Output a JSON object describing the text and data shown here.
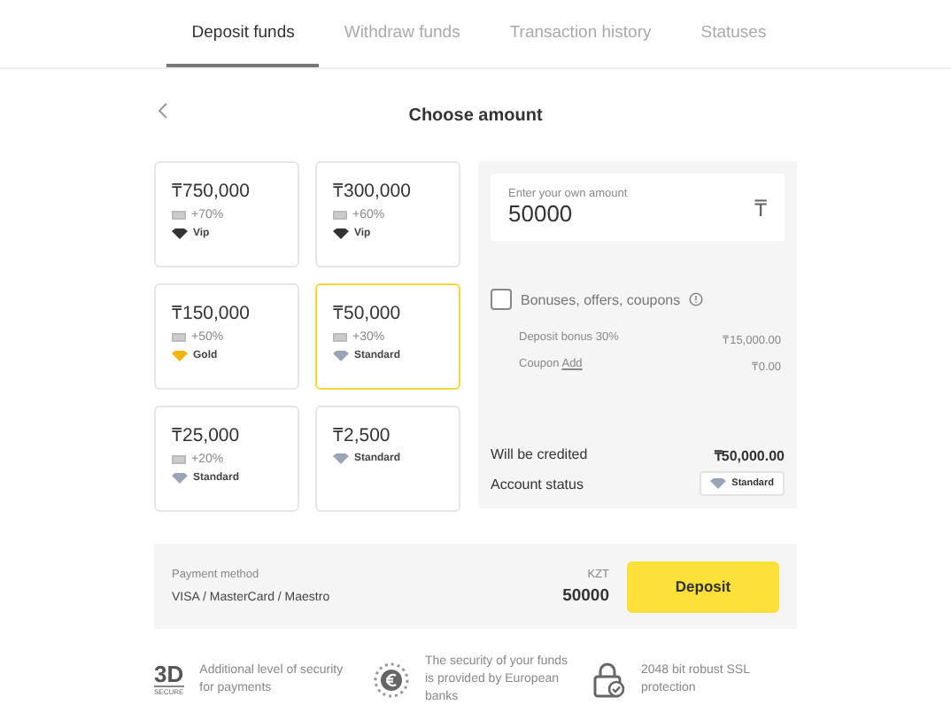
{
  "tabs": [
    {
      "label": "Deposit funds",
      "selected": true
    },
    {
      "label": "Withdraw funds",
      "selected": false
    },
    {
      "label": "Transaction history",
      "selected": false
    },
    {
      "label": "Statuses",
      "selected": false
    }
  ],
  "heading": "Choose amount",
  "amounts": [
    {
      "amount": "₸750,000",
      "bonus": "+70%",
      "tier": "Vip",
      "kind": "vip",
      "selected": false
    },
    {
      "amount": "₸300,000",
      "bonus": "+60%",
      "tier": "Vip",
      "kind": "vip",
      "selected": false
    },
    {
      "amount": "₸150,000",
      "bonus": "+50%",
      "tier": "Gold",
      "kind": "gold",
      "selected": false
    },
    {
      "amount": "₸50,000",
      "bonus": "+30%",
      "tier": "Standard",
      "kind": "standard",
      "selected": true
    },
    {
      "amount": "₸25,000",
      "bonus": "+20%",
      "tier": "Standard",
      "kind": "standard",
      "selected": false
    },
    {
      "amount": "₸2,500",
      "tier": "Standard",
      "kind": "standard",
      "selected": false
    }
  ],
  "own_amount": {
    "label": "Enter your own amount",
    "value": "50000",
    "currency_symbol": "₸"
  },
  "bonuses": {
    "label": "Bonuses, offers, coupons",
    "checked": false
  },
  "summary": [
    {
      "label": "Deposit bonus 30%",
      "value": "₸15,000.00"
    },
    {
      "label": "Coupon",
      "link": "Add",
      "value": "₸0.00"
    }
  ],
  "credited": {
    "label": "Will be credited",
    "value": "₸50,000.00"
  },
  "account_status": {
    "label": "Account status",
    "tier": "Standard",
    "kind": "standard"
  },
  "payment": {
    "label": "Payment method",
    "method": "VISA / MasterCard / Maestro",
    "currency": "KZT",
    "amount": "50000",
    "button": "Deposit"
  },
  "features": [
    {
      "kind": "secure",
      "logo": "3D",
      "logo_caption": "SECURE",
      "text": "Additional level of security for payments"
    },
    {
      "kind": "euro",
      "text": "The security of your funds is provided by European banks"
    },
    {
      "kind": "lock",
      "text": "2048 bit robust SSL protection"
    }
  ]
}
